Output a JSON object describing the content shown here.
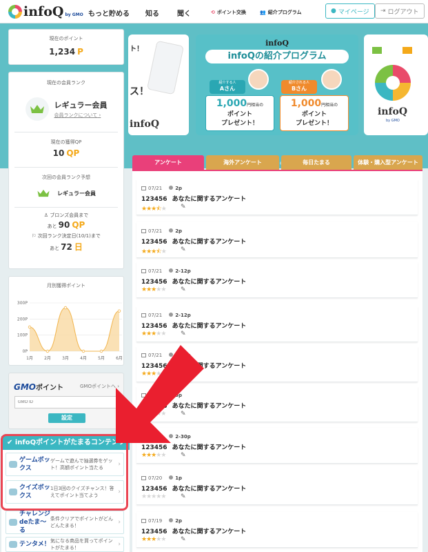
{
  "header": {
    "logo_text": "infoQ",
    "logo_sub": "by GMO",
    "nav": [
      "もっと貯める",
      "知る",
      "聞く"
    ],
    "points_exchange": "ポイント交換",
    "referral": "紹介プログラム",
    "mypage": "マイページ",
    "logout": "ログアウト"
  },
  "sidebar": {
    "current_points_label": "現在のポイント",
    "current_points": "1,234",
    "point_unit": "P",
    "rank_label": "現在の会員ランク",
    "rank_name": "レギュラー会員",
    "rank_link": "会員ランクについて",
    "qp_label": "現在の獲得QP",
    "qp_value": "10",
    "qp_unit": "QP",
    "next_rank_label": "次回の会員ランク予想",
    "next_rank_name": "レギュラー会員",
    "bronze_label": "ブロンズ会員まで",
    "bronze_prefix": "あと",
    "bronze_value": "90",
    "decide_label": "次回ランク決定日(10/1)まで",
    "decide_prefix": "あと",
    "decide_value": "72",
    "day_unit": "日",
    "monthly_label": "月別獲得ポイント"
  },
  "gmo": {
    "title_brand": "GMO",
    "title_rest": "ポイント",
    "link": "GMOポイントへ",
    "input_placeholder": "GMO ID",
    "button": "設定"
  },
  "contents": {
    "heading": "infoQポイントがたまるコンテンツ",
    "items": [
      {
        "name": "ゲームボックス",
        "desc": "ゲームで遊んで抽選券をゲット！高額ポイント当たる"
      },
      {
        "name": "クイズボックス",
        "desc": "1日3回のクイズチャンス！答えてポイント当てよう"
      },
      {
        "name": "チャレンジdeたま〜る",
        "desc": "条件クリアでポイントがどんどんたまる！"
      },
      {
        "name": "テンタメ！",
        "desc": "気になる商品を買ってポイントがたまる！"
      }
    ]
  },
  "banner": {
    "title": "infoQの紹介プログラム",
    "person_a_role": "紹介する人",
    "person_a": "Aさん",
    "person_b_role": "紹介される人",
    "person_b": "Bさん",
    "amount": "1,000",
    "amount_unit": "円相当の",
    "present_1": "ポイント",
    "present_2": "プレゼント！",
    "left_text_1": "ト！",
    "left_text_2": "ス！",
    "right_logo": "infoQ",
    "right_sub": "by GMO"
  },
  "tabs": [
    "アンケート",
    "海外アンケート",
    "毎日たまる",
    "体験・購入型アンケート"
  ],
  "surveys": [
    {
      "date": "07/21",
      "points": "2p",
      "id": "123456",
      "title": "あなたに関するアンケート",
      "rating": 3.5
    },
    {
      "date": "07/21",
      "points": "2p",
      "id": "123456",
      "title": "あなたに関するアンケート",
      "rating": 3.5
    },
    {
      "date": "07/21",
      "points": "2-12p",
      "id": "123456",
      "title": "あなたに関するアンケート",
      "rating": 3
    },
    {
      "date": "07/21",
      "points": "2-12p",
      "id": "123456",
      "title": "あなたに関するアンケート",
      "rating": 3
    },
    {
      "date": "07/21",
      "points": "2-96p",
      "id": "123456",
      "title": "あなたに関するアンケート",
      "rating": 3
    },
    {
      "date": "07/21",
      "points": "5p",
      "id": "123456",
      "title": "あなたに関するアンケート",
      "rating": 3
    },
    {
      "date": "07/21",
      "points": "2-30p",
      "id": "123456",
      "title": "あなたに関するアンケート",
      "rating": 3
    },
    {
      "date": "07/20",
      "points": "1p",
      "id": "123456",
      "title": "あなたに関するアンケート",
      "rating": 0
    },
    {
      "date": "07/19",
      "points": "2p",
      "id": "123456",
      "title": "あなたに関するアンケート",
      "rating": 3
    }
  ],
  "colors": {
    "teal": "#3bb7c2",
    "pink": "#e9407a",
    "orange": "#f4a91a",
    "highlight_red": "#ea4553"
  },
  "chart_data": {
    "type": "area",
    "categories": [
      "1月",
      "2月",
      "3月",
      "4月",
      "5月",
      "6月"
    ],
    "values": [
      150,
      0,
      270,
      0,
      0,
      250
    ],
    "yticks": [
      "0P",
      "100P",
      "200P",
      "300P"
    ],
    "ylim": [
      0,
      300
    ],
    "grid": true
  }
}
